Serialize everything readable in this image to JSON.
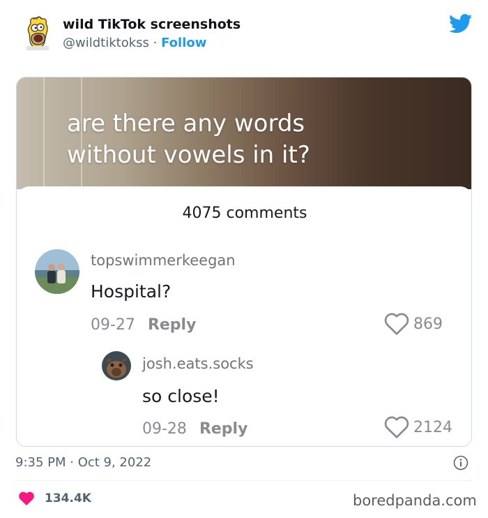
{
  "author": {
    "name": "wild TikTok screenshots",
    "handle": "@wildtiktokss",
    "separator": "·",
    "follow_label": "Follow"
  },
  "video": {
    "caption_line1": "are there any words",
    "caption_line2": "without vowels in it?"
  },
  "comments_panel": {
    "count_label": "4075 comments",
    "comments": [
      {
        "username": "topswimmerkeegan",
        "text": "Hospital?",
        "date": "09-27",
        "reply_label": "Reply",
        "likes": "869"
      },
      {
        "username": "josh.eats.socks",
        "text": "so close!",
        "date": "09-28",
        "reply_label": "Reply",
        "likes": "2124"
      }
    ]
  },
  "footer": {
    "timestamp": "9:35 PM · Oct 9, 2022",
    "like_count": "134.4K",
    "watermark": "boredpanda.com"
  },
  "icons": {
    "avatar": "homer-simpson-avatar",
    "brand": "twitter-bird-icon",
    "like": "heart-outline-icon",
    "tweet_like": "heart-filled-icon",
    "info": "info-icon"
  },
  "colors": {
    "twitter_blue": "#1d9bf0",
    "like_red": "#f91880",
    "text_primary": "#0f1419",
    "text_secondary": "#536471",
    "tiktok_gray": "#8a8b91"
  }
}
